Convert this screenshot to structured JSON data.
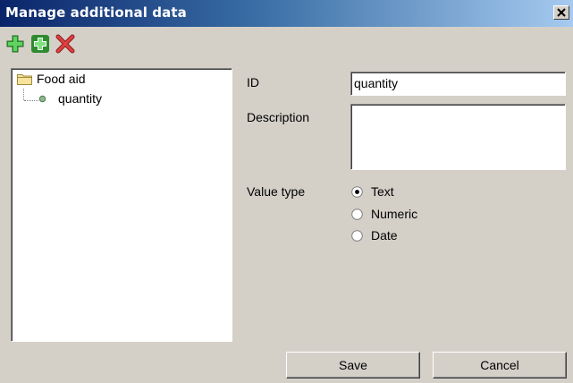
{
  "window": {
    "title": "Manage additional data"
  },
  "toolbar": {
    "icons": [
      "add-green-plus-icon",
      "add-child-plus-icon",
      "delete-red-x-icon"
    ]
  },
  "tree": {
    "root": {
      "label": "Food aid",
      "icon": "folder-icon"
    },
    "children": [
      {
        "label": "quantity",
        "icon": "item-dot-icon"
      }
    ]
  },
  "form": {
    "id_label": "ID",
    "id_value": "quantity",
    "description_label": "Description",
    "description_value": "",
    "value_type_label": "Value type",
    "value_type_options": [
      "Text",
      "Numeric",
      "Date"
    ],
    "value_type_selected": "Text"
  },
  "buttons": {
    "save": "Save",
    "cancel": "Cancel"
  },
  "colors": {
    "titlebar_start": "#0a246a",
    "titlebar_end": "#a6caf0",
    "face": "#d4d0c8"
  }
}
